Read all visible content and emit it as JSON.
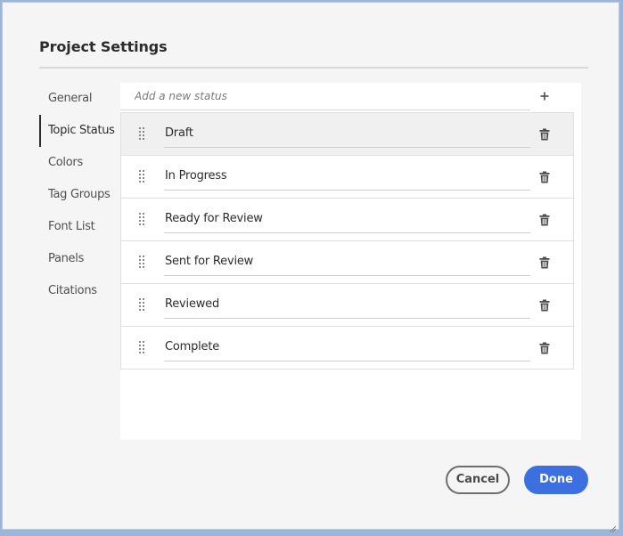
{
  "dialog": {
    "title": "Project Settings"
  },
  "nav": {
    "items": [
      {
        "label": "General",
        "selected": false
      },
      {
        "label": "Topic Status",
        "selected": true
      },
      {
        "label": "Colors",
        "selected": false
      },
      {
        "label": "Tag Groups",
        "selected": false
      },
      {
        "label": "Font List",
        "selected": false
      },
      {
        "label": "Panels",
        "selected": false
      },
      {
        "label": "Citations",
        "selected": false
      }
    ]
  },
  "status": {
    "add_placeholder": "Add a new status",
    "add_icon": "plus-icon",
    "drag_icon": "drag-handle-icon",
    "delete_icon": "trash-icon",
    "items": [
      {
        "label": "Draft",
        "highlighted": true
      },
      {
        "label": "In Progress",
        "highlighted": false
      },
      {
        "label": "Ready for Review",
        "highlighted": false
      },
      {
        "label": "Sent for Review",
        "highlighted": false
      },
      {
        "label": "Reviewed",
        "highlighted": false
      },
      {
        "label": "Complete",
        "highlighted": false
      }
    ]
  },
  "footer": {
    "cancel_label": "Cancel",
    "done_label": "Done"
  },
  "colors": {
    "accent": "#3c6fe0",
    "window_frame": "#9cb6da",
    "dialog_bg": "#f5f5f5",
    "highlight_row": "#f0f0f0"
  }
}
